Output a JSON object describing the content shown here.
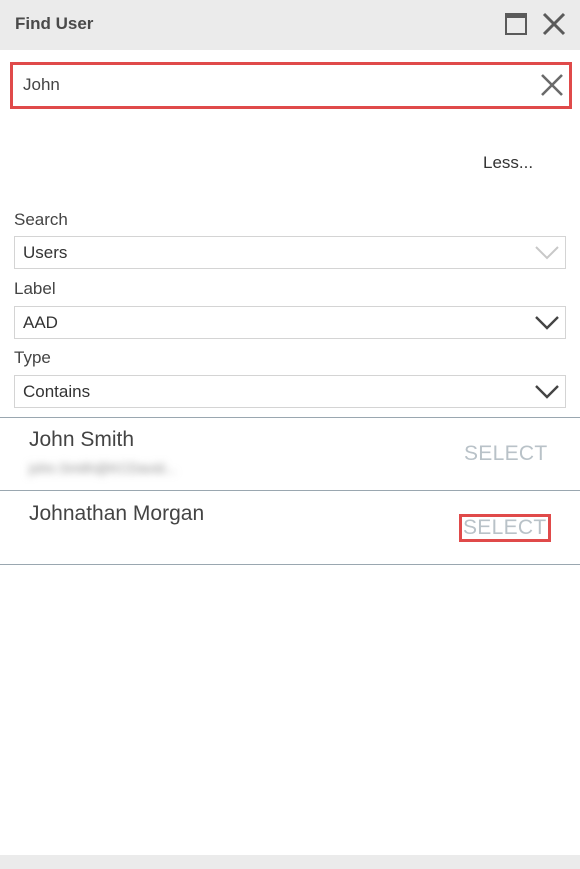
{
  "window": {
    "title": "Find User",
    "maximize_icon": "window-maximize-icon",
    "close_icon": "close-icon"
  },
  "search": {
    "value": "John",
    "clear_icon": "close-icon"
  },
  "less_link": "Less...",
  "fields": {
    "search": {
      "label": "Search",
      "value": "Users"
    },
    "label": {
      "label": "Label",
      "value": "AAD"
    },
    "type": {
      "label": "Type",
      "value": "Contains"
    }
  },
  "results": [
    {
      "name": "John Smith",
      "email": "john.Smith@KCDavid...",
      "action": "SELECT"
    },
    {
      "name": "Johnathan Morgan",
      "action": "SELECT"
    }
  ],
  "colors": {
    "highlight": "#e04a4a",
    "header_bg": "#ebebeb",
    "select_text": "#b9c2c8"
  }
}
